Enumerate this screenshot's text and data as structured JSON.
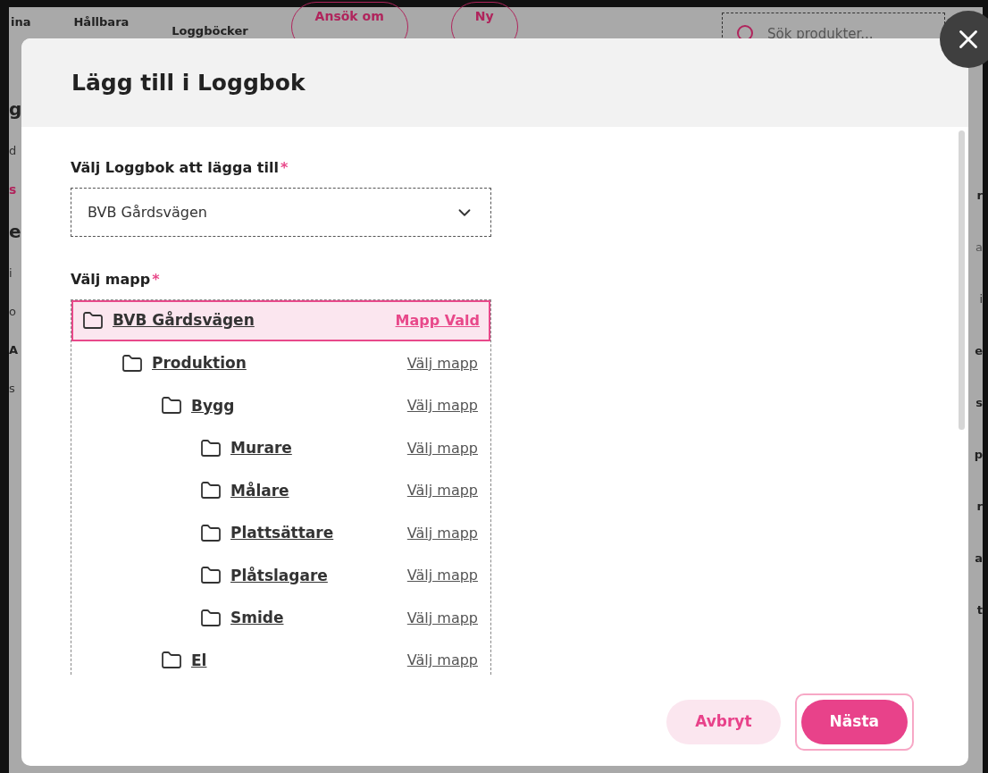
{
  "background": {
    "nav": [
      {
        "label": "ina",
        "kind": "text"
      },
      {
        "label": "Hållbara",
        "kind": "text"
      },
      {
        "label": "Loggböcker",
        "kind": "text"
      },
      {
        "label": "Ansök om",
        "kind": "pill"
      },
      {
        "label": "Ny",
        "kind": "pill"
      }
    ],
    "search": {
      "placeholder": "Sök produkter..."
    },
    "left_fragments": [
      {
        "text": "g",
        "kind": "heading"
      },
      {
        "text": "d",
        "kind": "text"
      },
      {
        "text": "s",
        "kind": "link"
      },
      {
        "text": "e",
        "kind": "heading"
      },
      {
        "text": "i",
        "kind": "text"
      },
      {
        "text": "o",
        "kind": "text"
      },
      {
        "text": "A",
        "kind": "bold"
      },
      {
        "text": "s",
        "kind": "text"
      }
    ],
    "right_fragments": [
      {
        "text": "r",
        "kind": "bold"
      },
      {
        "text": "a",
        "kind": "muted"
      },
      {
        "text": "i",
        "kind": "text"
      },
      {
        "text": "e",
        "kind": "bold"
      },
      {
        "text": "s",
        "kind": "bold"
      },
      {
        "text": "p",
        "kind": "bold"
      },
      {
        "text": "r",
        "kind": "bold"
      },
      {
        "text": "a",
        "kind": "bold"
      },
      {
        "text": "t",
        "kind": "bold"
      }
    ]
  },
  "modal": {
    "title": "Lägg till i Loggbok",
    "logbook_field": {
      "label": "Välj Loggbok att lägga till",
      "required_mark": "*",
      "value": "BVB Gårdsvägen"
    },
    "folder_field": {
      "label": "Välj mapp",
      "required_mark": "*"
    },
    "tree": [
      {
        "label": "BVB Gårdsvägen",
        "action": "Mapp Vald",
        "selected": true,
        "children": [
          {
            "label": "Produktion",
            "action": "Välj mapp",
            "selected": false,
            "children": [
              {
                "label": "Bygg",
                "action": "Välj mapp",
                "selected": false,
                "children": [
                  {
                    "label": "Murare",
                    "action": "Välj mapp",
                    "selected": false
                  },
                  {
                    "label": "Målare",
                    "action": "Välj mapp",
                    "selected": false
                  },
                  {
                    "label": "Plattsättare",
                    "action": "Välj mapp",
                    "selected": false
                  },
                  {
                    "label": "Plåtslagare",
                    "action": "Välj mapp",
                    "selected": false
                  },
                  {
                    "label": "Smide",
                    "action": "Välj mapp",
                    "selected": false
                  }
                ]
              },
              {
                "label": "El",
                "action": "Välj mapp",
                "selected": false
              }
            ]
          }
        ]
      }
    ],
    "buttons": [
      {
        "label": "Avbryt",
        "kind": "secondary"
      },
      {
        "label": "Nästa",
        "kind": "primary"
      }
    ]
  }
}
